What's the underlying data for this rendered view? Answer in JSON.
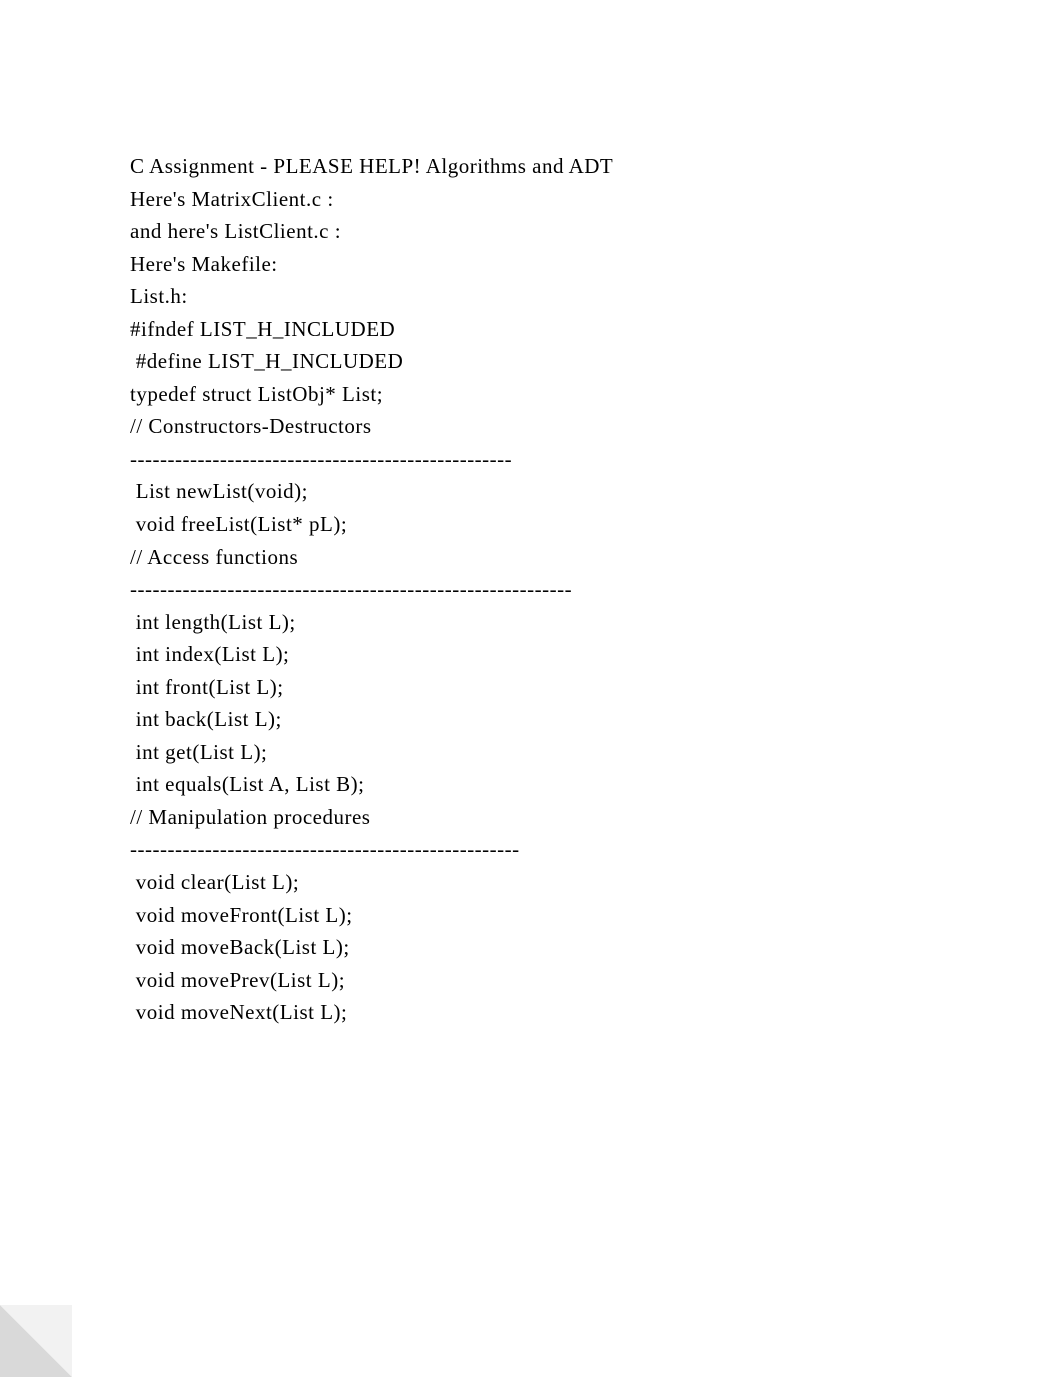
{
  "lines": [
    "C Assignment - PLEASE HELP! Algorithms and ADT",
    "Here's MatrixClient.c :",
    "and here's ListClient.c :",
    "Here's Makefile:",
    "List.h:",
    "#ifndef LIST_H_INCLUDED",
    " #define LIST_H_INCLUDED",
    "typedef struct ListObj* List;",
    "// Constructors-Destructors",
    "---------------------------------------------------",
    " List newList(void);",
    " void freeList(List* pL);",
    "// Access functions",
    "-----------------------------------------------------------",
    " int length(List L);",
    " int index(List L);",
    " int front(List L);",
    " int back(List L);",
    " int get(List L);",
    " int equals(List A, List B);",
    "// Manipulation procedures",
    "----------------------------------------------------",
    " void clear(List L);",
    " void moveFront(List L);",
    " void moveBack(List L);",
    " void movePrev(List L);",
    " void moveNext(List L);"
  ]
}
